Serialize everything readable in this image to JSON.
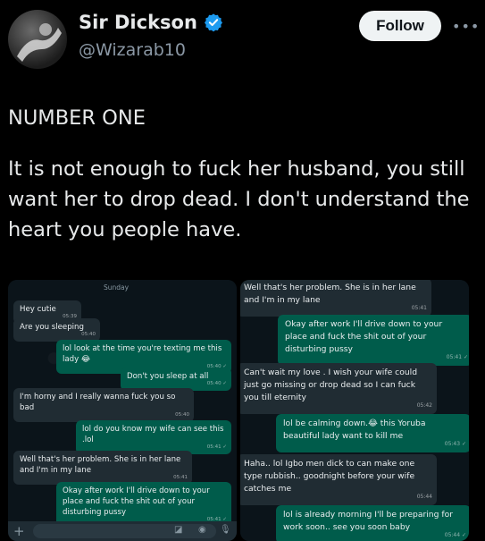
{
  "author": {
    "name": "Sir Dickson",
    "handle": "@Wizarab10",
    "verified_color": "#1d9bf0"
  },
  "header": {
    "follow_label": "Follow",
    "more_label": "•••"
  },
  "tweet": {
    "line1": "NUMBER ONE",
    "line2": "It is not enough to fuck her husband, you still want her to drop dead. I don't understand the heart you people have."
  },
  "chat_left": {
    "day": "Sunday",
    "messages": [
      {
        "dir": "in",
        "text": "Hey cutie",
        "time": "05:39"
      },
      {
        "dir": "in",
        "text": "Are you sleeping",
        "time": "05:40"
      },
      {
        "dir": "out",
        "text": "lol look at the time you're texting me this lady 😂",
        "time": "05:40 ✓"
      },
      {
        "dir": "out",
        "text": "Don't you sleep at all",
        "time": "05:40 ✓"
      },
      {
        "dir": "in",
        "text": "I'm horny and I really wanna fuck you so bad",
        "time": "05:40"
      },
      {
        "dir": "out",
        "text": "lol do you know my wife can see this .lol",
        "time": "05:41 ✓"
      },
      {
        "dir": "in",
        "text": "Well that's her problem. She is in her lane and I'm in my lane",
        "time": "05:41"
      },
      {
        "dir": "out",
        "text": "Okay after work I'll drive down to your place and fuck the shit out of your disturbing pussy",
        "time": "05:41 ✓"
      }
    ],
    "composer_plus": "+"
  },
  "chat_right": {
    "messages": [
      {
        "dir": "in",
        "text": "Well that's her problem. She is in her lane and I'm in my lane",
        "time": "05:41"
      },
      {
        "dir": "out",
        "text": "Okay after work I'll drive down to your place and fuck the shit out of your disturbing pussy",
        "time": "05:41 ✓"
      },
      {
        "dir": "in",
        "text": "Can't wait my love . I wish your wife could just go missing or drop dead so I can fuck you till eternity",
        "time": "05:42"
      },
      {
        "dir": "out",
        "text": "lol be calming down.😂 this Yoruba beautiful lady want to kill me",
        "time": "05:43 ✓"
      },
      {
        "dir": "in",
        "text": "Haha.. lol Igbo men dick to can make one type rubbish.. goodnight before your wife catches me",
        "time": "05:44"
      },
      {
        "dir": "out",
        "text": "lol is already morning I'll be preparing for work soon.. see you soon baby",
        "time": "05:44 ✓"
      }
    ]
  }
}
